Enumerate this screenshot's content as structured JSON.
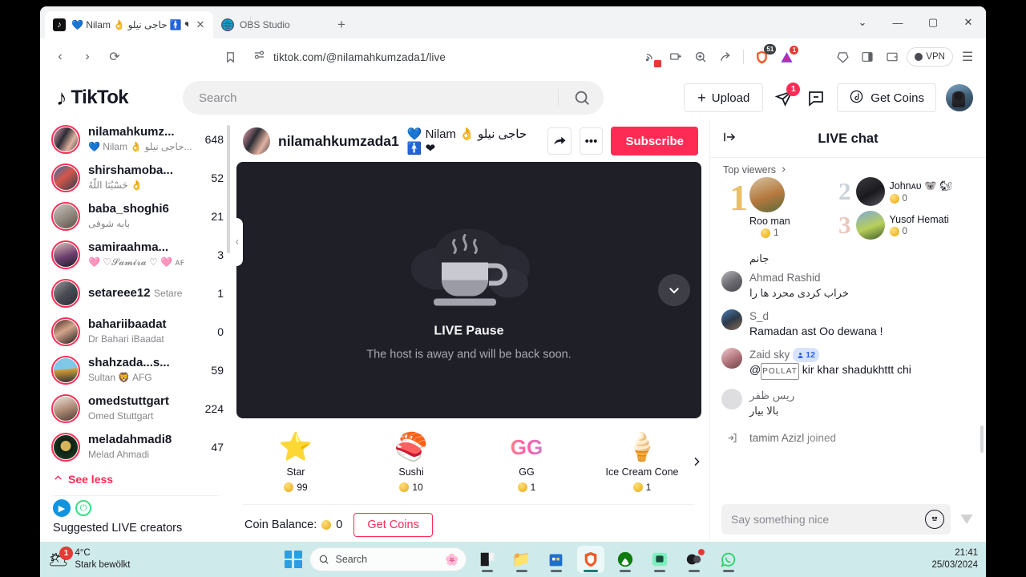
{
  "browser": {
    "tabs": [
      {
        "title": "💙 Nilam 👌 حاجی نیلو 🚹 ❤ (@",
        "favicon": "tiktok-icon",
        "active": true
      },
      {
        "title": "OBS Studio",
        "favicon": "globe-icon",
        "active": false
      }
    ],
    "new_tab_label": "+",
    "window_controls": {
      "minimize": "—",
      "maximize": "▢",
      "close": "✕",
      "tablist": "⌄"
    },
    "nav": {
      "back": "‹",
      "forward": "›",
      "reload": "⟳",
      "bookmark": "🔖"
    },
    "url": "tiktok.com/@nilamahkumzada1/live",
    "toolbar_icons": [
      {
        "name": "cast-blocked-icon",
        "glyph": "((•))"
      },
      {
        "name": "device-add-icon",
        "glyph": "▭"
      },
      {
        "name": "zoom-icon",
        "glyph": "⊕"
      },
      {
        "name": "share-icon",
        "glyph": "↗"
      },
      {
        "name": "brave-shields-icon",
        "glyph": "🦁",
        "badge": "51"
      },
      {
        "name": "extension-alert-icon",
        "glyph": "▲",
        "badge": "1"
      },
      {
        "name": "rewards-icon",
        "glyph": "⬡"
      },
      {
        "name": "sidebar-icon",
        "glyph": "▣"
      },
      {
        "name": "wallet-icon",
        "glyph": "▤"
      }
    ],
    "vpn_label": "VPN",
    "menu_icon": "☰"
  },
  "tiktok_header": {
    "logo_text": "TikTok",
    "search_placeholder": "Search",
    "search_icon": "search-icon",
    "upload_label": "Upload",
    "upload_plus": "+",
    "inbox_icon": "paper-plane-icon",
    "inbox_badge": "1",
    "messages_icon": "message-icon",
    "get_coins_label": "Get Coins",
    "profile_avatar": "user-avatar"
  },
  "sidebar": {
    "creators": [
      {
        "username": "nilamahkumz...",
        "display": "💙 Nilam 👌 حاجی نیلو...",
        "count": "648"
      },
      {
        "username": "shirshamoba...",
        "display": "حَسْبُنَا اللّٰهُ 👌",
        "count": "52"
      },
      {
        "username": "baba_shoghi6",
        "display": "بابه شوقی",
        "count": "21"
      },
      {
        "username": "samiraahma...",
        "display": "🩷 ♡𝓢𝓪𝓶𝓲𝓻𝓪 ♡ 🩷 ᴀꜰ",
        "count": "3"
      },
      {
        "username": "setareee12",
        "display": "Setare",
        "count": "1"
      },
      {
        "username": "bahariibaadat",
        "display": "Dr Bahari iBaadat",
        "count": "0"
      },
      {
        "username": "shahzada...s...",
        "display": "Sultan 🦁 AFG",
        "count": "59"
      },
      {
        "username": "omedstuttgart",
        "display": "Omed Stuttgart",
        "count": "224"
      },
      {
        "username": "meladahmadi8",
        "display": "Melad Ahmadi",
        "count": "47"
      }
    ],
    "see_less_label": "See less",
    "see_less_icon": "chevron-up-icon",
    "suggested_title": "Suggested LIVE creators",
    "collapse_handle_icon": "chevron-left-icon"
  },
  "live": {
    "host_username": "nilamahkumzada1",
    "host_tags": "💙 Nilam 👌 حاجی نیلو 🚹 ❤",
    "share_icon": "share-arrow-icon",
    "more_icon": "more-dots-icon",
    "subscribe_label": "Subscribe",
    "pause_title": "LIVE Pause",
    "pause_subtitle": "The host is away and will be back soon.",
    "pause_icon": "coffee-cup-icon",
    "expand_icon": "chevron-down-icon",
    "gifts": [
      {
        "name": "Star",
        "price": "99",
        "emoji": "⭐"
      },
      {
        "name": "Sushi",
        "price": "10",
        "emoji": "🍣"
      },
      {
        "name": "GG",
        "price": "1",
        "emoji": "GG"
      },
      {
        "name": "Ice Cream Cone",
        "price": "1",
        "emoji": "🍦"
      }
    ],
    "gift_next_icon": "chevron-right-icon",
    "coin_balance_label": "Coin Balance:",
    "coin_balance_value": "0",
    "get_coins_label": "Get Coins"
  },
  "chat": {
    "title": "LIVE chat",
    "collapse_icon": "collapse-right-icon",
    "top_viewers_label": "Top viewers",
    "top_viewers_chevron": "chevron-right-icon",
    "top_viewers": [
      {
        "rank": "1",
        "name": "Roo man",
        "coins": "1"
      },
      {
        "rank": "2",
        "name": "Johnᴀᴜ 🐨 🐿",
        "coins": "0"
      },
      {
        "rank": "3",
        "name": "Yusof Hemati",
        "coins": "0"
      }
    ],
    "messages": [
      {
        "type": "text-only",
        "text": "جانم"
      },
      {
        "type": "message",
        "name": "Ahmad Rashid",
        "text": "خراب کردی محرد ها را",
        "rtl": true
      },
      {
        "type": "message",
        "name": "S_d",
        "text": "Ramadan ast Oo dewana !",
        "rtl": false
      },
      {
        "type": "message",
        "name": "Zaid sky",
        "badge": "12",
        "mention": "POLLAT",
        "text": "kir khar shadukhttt chi",
        "rtl": false
      },
      {
        "type": "message",
        "name": "ریس ظفر",
        "text": "بالا بیار",
        "rtl": true
      },
      {
        "type": "join",
        "name": "tamim Azizl",
        "text": "joined",
        "icon": "enter-arrow-icon"
      }
    ],
    "input_placeholder": "Say something nice",
    "emoji_icon": "emoji-icon",
    "send_icon": "send-icon"
  },
  "taskbar": {
    "weather_temp": "4°C",
    "weather_desc": "Stark bewölkt",
    "weather_badge": "1",
    "weather_icon": "cloudy-icon",
    "start_icon": "windows-start-icon",
    "search_placeholder": "Search",
    "apps": [
      {
        "name": "logitech-icon",
        "glyph": "◨"
      },
      {
        "name": "file-explorer-icon",
        "glyph": "📁"
      },
      {
        "name": "microsoft-store-icon",
        "glyph": "🛍"
      },
      {
        "name": "brave-browser-icon",
        "glyph": "🦁",
        "active": true
      },
      {
        "name": "xbox-icon",
        "glyph": "🎮"
      },
      {
        "name": "obs-studio-icon",
        "glyph": "🎬"
      },
      {
        "name": "discord-icon",
        "glyph": "🎧",
        "dot": true
      },
      {
        "name": "whatsapp-icon",
        "glyph": "💬"
      }
    ],
    "time": "21:41",
    "date": "25/03/2024"
  },
  "colors": {
    "tiktok_red": "#fe2c55",
    "tiktok_cyan": "#25f4ee",
    "text_primary": "#161823",
    "text_secondary": "#86878b",
    "taskbar_bg": "#cfeaea"
  }
}
